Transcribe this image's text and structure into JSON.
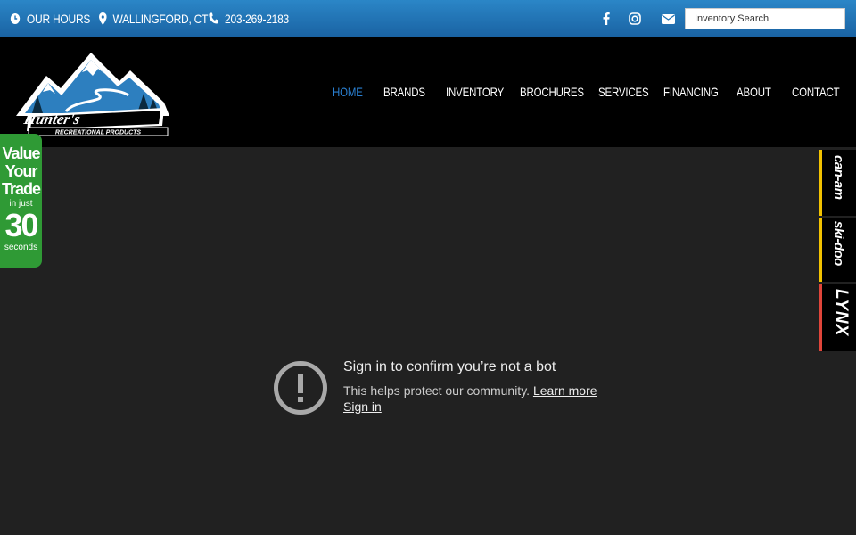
{
  "topbar": {
    "hours": "OUR HOURS",
    "location": "WALLINGFORD, CT",
    "phone": "203-269-2183",
    "search_placeholder": "Inventory Search"
  },
  "header": {
    "logo_icon": "hunters-recreational-products-logo",
    "nav": [
      {
        "label": "HOME",
        "active": true
      },
      {
        "label": "BRANDS"
      },
      {
        "label": "INVENTORY"
      },
      {
        "label": "BROCHURES"
      },
      {
        "label": "SERVICES"
      },
      {
        "label": "FINANCING"
      },
      {
        "label": "ABOUT"
      },
      {
        "label": "CONTACT"
      }
    ]
  },
  "trade_badge": {
    "line1": "Value",
    "line2": "Your",
    "line3": "Trade",
    "line4": "in just",
    "number": "30",
    "line5": "seconds",
    "color": "#2f9a35"
  },
  "brand_tabs": [
    {
      "label": "can-am",
      "accent": "#f2c200"
    },
    {
      "label": "ski-doo",
      "accent": "#f2c200"
    },
    {
      "label": "LYNX",
      "accent": "#e0453a"
    }
  ],
  "bot_notice": {
    "title": "Sign in to confirm you’re not a bot",
    "text": "This helps protect our community.",
    "learn_more": "Learn more",
    "sign_in": "Sign in"
  },
  "colors": {
    "topbar": "#1f72b5",
    "nav_active": "#2a7fd0",
    "background": "#212121"
  }
}
